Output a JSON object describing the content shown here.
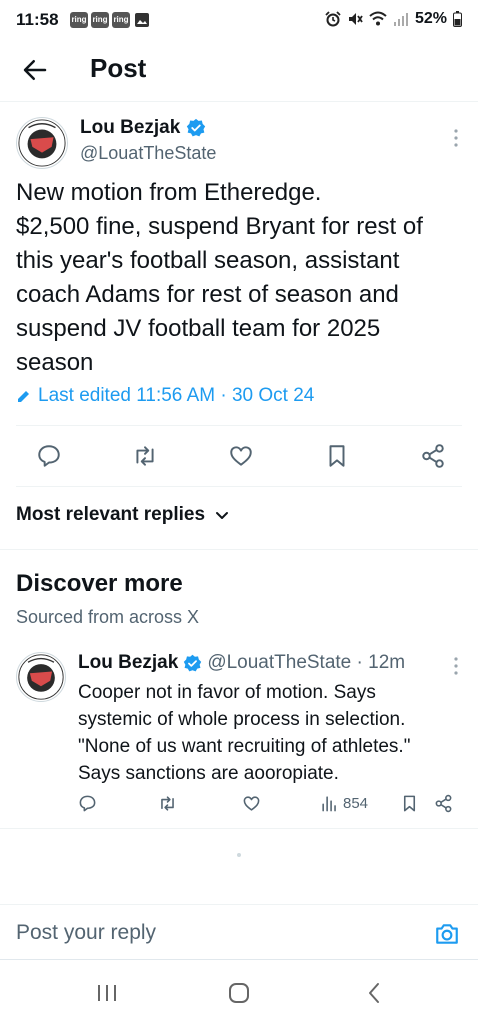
{
  "status_bar": {
    "time": "11:58",
    "notifications": [
      "ring",
      "ring",
      "ring"
    ],
    "battery": "52%",
    "icons": [
      "gallery-icon",
      "alarm-icon",
      "mute-icon",
      "wifi-icon",
      "signal-icon",
      "battery-icon"
    ]
  },
  "header": {
    "title": "Post",
    "back_icon": "arrow-left-icon"
  },
  "post": {
    "author_name": "Lou Bezjak",
    "author_handle": "@LouatTheState",
    "text_lines": [
      "New motion from Etheredge.",
      "$2,500 fine, suspend Bryant for rest of",
      "this year's football season, assistant",
      "coach Adams for rest of season and",
      "suspend JV football team for 2025",
      "season"
    ],
    "edited_label": "Last edited 11:56 AM · 30 Oct 24",
    "actions": [
      "reply-icon",
      "retweet-icon",
      "like-icon",
      "bookmark-icon",
      "share-icon"
    ]
  },
  "replies_filter": {
    "label": "Most relevant replies"
  },
  "discover": {
    "title": "Discover more",
    "subtitle": "Sourced from across X",
    "item": {
      "author_name": "Lou Bezjak",
      "handle_time": "@LouatTheState · 12m",
      "text_lines": [
        "Cooper not in favor of motion. Says",
        "systemic of whole process in selection.",
        "\"None of us want recruiting of athletes.\"",
        "Says sanctions are aooropiate."
      ],
      "views": "854"
    }
  },
  "reply_box": {
    "placeholder": "Post your reply"
  },
  "colors": {
    "accent": "#1d9bf0",
    "text": "#0f1419",
    "secondary": "#536471"
  }
}
